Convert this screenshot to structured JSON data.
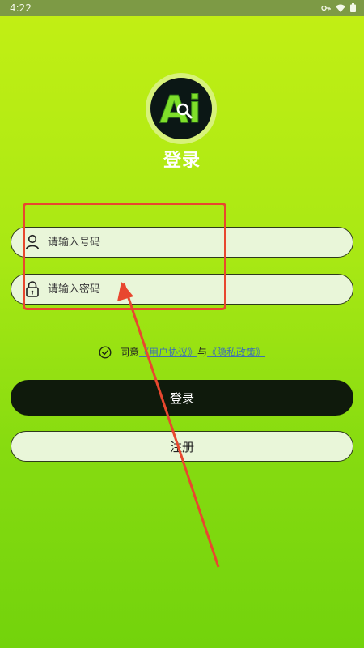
{
  "status_bar": {
    "time": "4:22"
  },
  "logo": {
    "text": "Ai"
  },
  "title": "登录",
  "phone_field": {
    "placeholder": "请输入号码"
  },
  "password_field": {
    "placeholder": "请输入密码"
  },
  "agreement": {
    "prefix": "同意",
    "user_agreement": "《用户协议》",
    "joiner": "与",
    "privacy_policy": "《隐私政策》",
    "checked": true
  },
  "buttons": {
    "login": "登录",
    "register": "注册"
  },
  "colors": {
    "accent": "#a8e814",
    "dark_button": "#0f1a0c",
    "field_bg": "#e9f6d9",
    "link": "#3d6fb5",
    "annotation": "#e8472f"
  },
  "icons": {
    "user": "user-icon",
    "lock": "lock-icon",
    "check": "check-circle-icon",
    "search": "magnifier-icon"
  }
}
